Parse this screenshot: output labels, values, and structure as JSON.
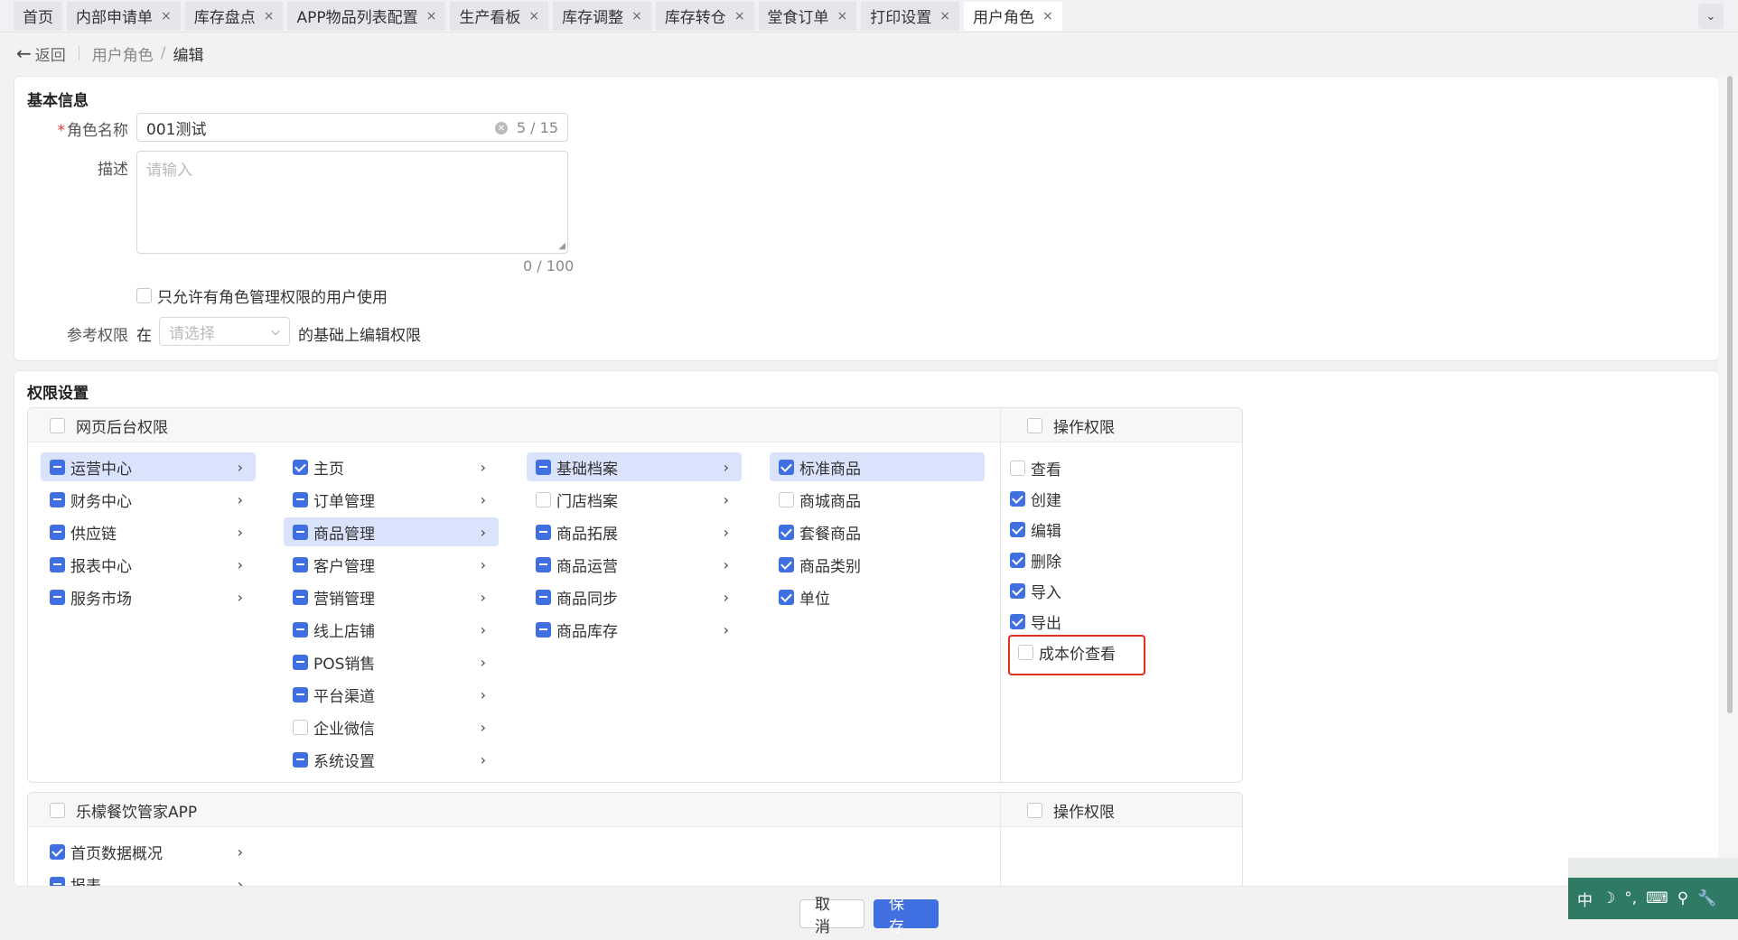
{
  "tabs": [
    {
      "label": "首页",
      "closable": false,
      "active": false
    },
    {
      "label": "内部申请单",
      "closable": true,
      "active": false
    },
    {
      "label": "库存盘点",
      "closable": true,
      "active": false
    },
    {
      "label": "APP物品列表配置",
      "closable": true,
      "active": false
    },
    {
      "label": "生产看板",
      "closable": true,
      "active": false
    },
    {
      "label": "库存调整",
      "closable": true,
      "active": false
    },
    {
      "label": "库存转仓",
      "closable": true,
      "active": false
    },
    {
      "label": "堂食订单",
      "closable": true,
      "active": false
    },
    {
      "label": "打印设置",
      "closable": true,
      "active": false
    },
    {
      "label": "用户角色",
      "closable": true,
      "active": true
    }
  ],
  "tab_close_glyph": "×",
  "tab_collapse_glyph": "⌄",
  "breadcrumb": {
    "back": "返回",
    "parent": "用户角色",
    "slash": "/",
    "current": "编辑"
  },
  "basic": {
    "title": "基本信息",
    "required_mark": "*",
    "role_label": "角色名称",
    "role_value": "001测试",
    "role_count": "5 / 15",
    "desc_label": "描述",
    "desc_placeholder": "请输入",
    "desc_count": "0 / 100",
    "only_admin_label": "只允许有角色管理权限的用户使用",
    "ref_label": "参考权限",
    "ref_prefix": "在",
    "ref_placeholder": "请选择",
    "ref_suffix": "的基础上编辑权限"
  },
  "perm": {
    "title": "权限设置",
    "web_header": "网页后台权限",
    "op_header": "操作权限",
    "col1": [
      {
        "label": "运营中心",
        "state": "partial",
        "selected": true
      },
      {
        "label": "财务中心",
        "state": "partial"
      },
      {
        "label": "供应链",
        "state": "partial"
      },
      {
        "label": "报表中心",
        "state": "partial"
      },
      {
        "label": "服务市场",
        "state": "partial"
      }
    ],
    "col2": [
      {
        "label": "主页",
        "state": "checked"
      },
      {
        "label": "订单管理",
        "state": "partial"
      },
      {
        "label": "商品管理",
        "state": "partial",
        "selected": true
      },
      {
        "label": "客户管理",
        "state": "partial"
      },
      {
        "label": "营销管理",
        "state": "partial"
      },
      {
        "label": "线上店铺",
        "state": "partial"
      },
      {
        "label": "POS销售",
        "state": "partial"
      },
      {
        "label": "平台渠道",
        "state": "partial"
      },
      {
        "label": "企业微信",
        "state": "unchecked"
      },
      {
        "label": "系统设置",
        "state": "partial"
      }
    ],
    "col3": [
      {
        "label": "基础档案",
        "state": "partial",
        "selected": true
      },
      {
        "label": "门店档案",
        "state": "unchecked"
      },
      {
        "label": "商品拓展",
        "state": "partial"
      },
      {
        "label": "商品运营",
        "state": "partial"
      },
      {
        "label": "商品同步",
        "state": "partial"
      },
      {
        "label": "商品库存",
        "state": "partial"
      }
    ],
    "col4": [
      {
        "label": "标准商品",
        "state": "checked",
        "selected": true
      },
      {
        "label": "商城商品",
        "state": "unchecked"
      },
      {
        "label": "套餐商品",
        "state": "checked"
      },
      {
        "label": "商品类别",
        "state": "checked"
      },
      {
        "label": "单位",
        "state": "checked"
      }
    ],
    "ops": [
      {
        "label": "查看",
        "state": "unchecked"
      },
      {
        "label": "创建",
        "state": "checked"
      },
      {
        "label": "编辑",
        "state": "checked"
      },
      {
        "label": "删除",
        "state": "checked"
      },
      {
        "label": "导入",
        "state": "checked"
      },
      {
        "label": "导出",
        "state": "checked"
      },
      {
        "label": "成本价查看",
        "state": "unchecked"
      }
    ],
    "app_header": "乐檬餐饮管家APP",
    "app_op_header": "操作权限",
    "app_items": [
      {
        "label": "首页数据概况",
        "state": "checked"
      },
      {
        "label": "报表",
        "state": "partial"
      }
    ],
    "chevron": "›",
    "highlight_color": "#e0301e"
  },
  "footer": {
    "cancel": "取 消",
    "save": "保 存"
  },
  "ime": {
    "glyphs": [
      "中",
      "☽",
      "°,",
      "⌨",
      "⚲",
      "🔧"
    ]
  },
  "colors": {
    "accent": "#3f6fe0",
    "selected_bg": "#d9e3fc",
    "ime_bg": "#2f7a64"
  }
}
